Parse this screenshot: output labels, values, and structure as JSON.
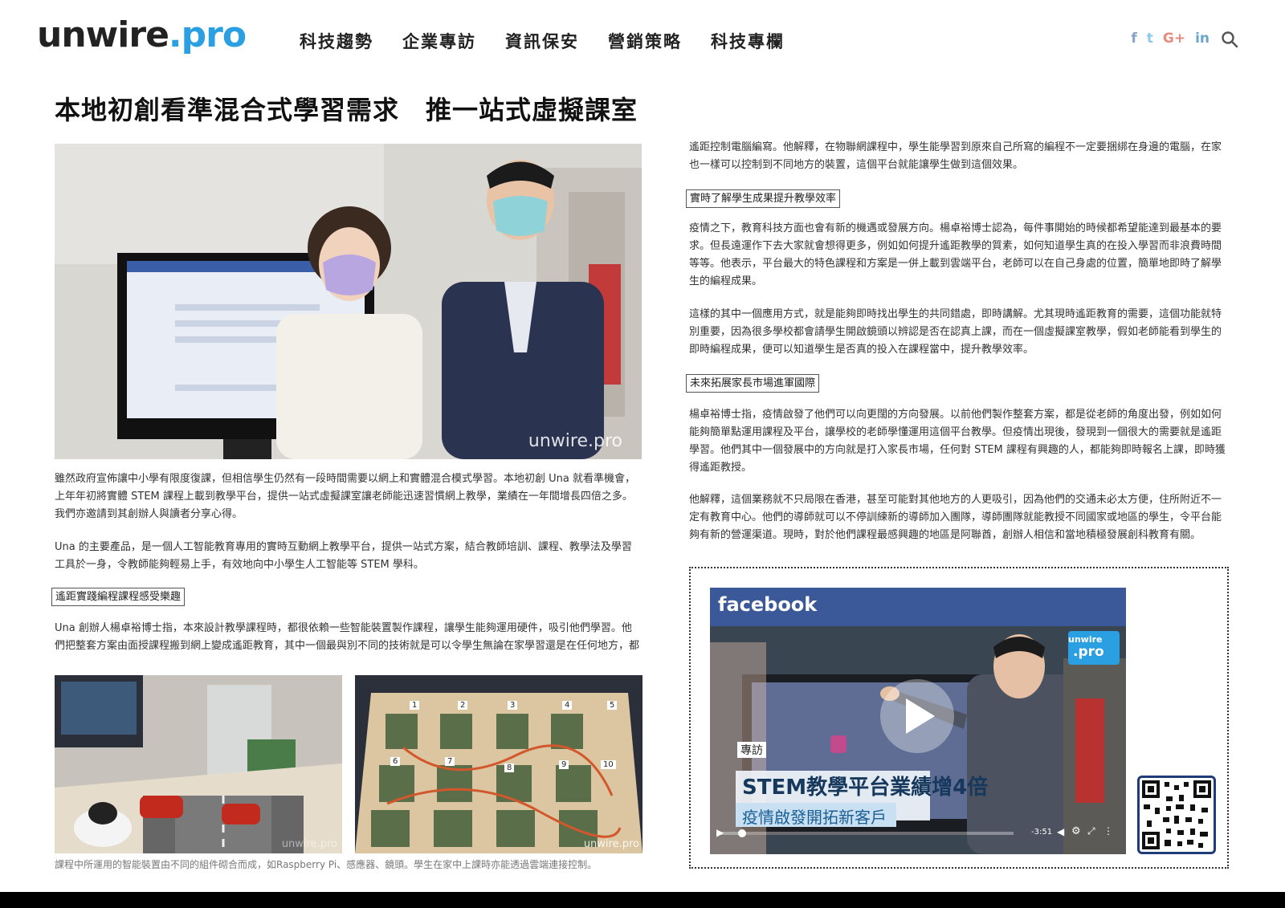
{
  "header": {
    "logo_main": "unwire",
    "logo_suffix": ".pro",
    "nav": [
      "科技趨勢",
      "企業專訪",
      "資訊保安",
      "營銷策略",
      "科技專欄"
    ],
    "social": [
      {
        "label": "f",
        "icon": "facebook-icon",
        "color": "#3b5998"
      },
      {
        "label": "t",
        "icon": "twitter-icon",
        "color": "#1da1f2"
      },
      {
        "label": "G+",
        "icon": "google-plus-icon",
        "color": "#dd4b39"
      },
      {
        "label": "in",
        "icon": "linkedin-icon",
        "color": "#0077b5"
      }
    ]
  },
  "article": {
    "title": "本地初創看準混合式學習需求　推一站式虛擬課室",
    "hero_watermark": "unwire.pro",
    "left": {
      "p1": "雖然政府宣佈讓中小學有限度復課，但相信學生仍然有一段時間需要以網上和實體混合模式學習。本地初創 Una 就看準機會，上年年初將實體 STEM 課程上載到教學平台，提供一站式虛擬課室讓老師能迅速習慣網上教學，業績在一年間增長四倍之多。我們亦邀請到其創辦人與讀者分享心得。",
      "p2": "Una 的主要產品，是一個人工智能教育專用的實時互動網上教學平台，提供一站式方案，結合教師培訓、課程、教學法及學習工具於一身，令教師能夠輕易上手，有效地向中小學生人工智能等 STEM 學科。",
      "sub1": "遙距實踐編程課程感受樂趣",
      "p3": "Una 創辦人楊卓裕博士指，本來設計教學課程時，都很依賴一些智能裝置製作課程，讓學生能夠運用硬件，吸引他們學習。他們把整套方案由面授課程搬到網上變成遙距教育，其中一個最與別不同的技術就是可以令學生無論在家學習還是在任何地方，都可以"
    },
    "photo2_watermark": "unwire.pro",
    "photo3_watermark": "unwire.pro",
    "photo3_numbers": [
      "1",
      "2",
      "3",
      "4",
      "5",
      "6",
      "7",
      "8",
      "9",
      "10"
    ],
    "caption": "課程中所運用的智能裝置由不同的組件砌合而成，如Raspberry Pi、感應器、鏡頭。學生在家中上課時亦能透過雲端連接控制。",
    "right": {
      "p1": "遙距控制電腦編寫。他解釋，在物聯網課程中，學生能學習到原來自己所寫的編程不一定要捆綁在身邊的電腦，在家也一樣可以控制到不同地方的裝置，這個平台就能讓學生做到這個效果。",
      "sub2": "實時了解學生成果提升教學效率",
      "p2": "疫情之下，教育科技方面也會有新的機遇或發展方向。楊卓裕博士認為，每件事開始的時候都希望能達到最基本的要求。但長遠運作下去大家就會想得更多，例如如何提升遙距教學的質素，如何知道學生真的在投入學習而非浪費時間等等。他表示，平台最大的特色課程和方案是一併上載到雲端平台，老師可以在自己身處的位置，簡單地即時了解學生的編程成果。",
      "p3": "這樣的其中一個應用方式，就是能夠即時找出學生的共同錯處，即時講解。尤其現時遙距教育的需要，這個功能就特別重要，因為很多學校都會請學生開啟鏡頭以辨認是否在認真上課，而在一個虛擬課室教學，假如老師能看到學生的即時編程成果，便可以知道學生是否真的投入在課程當中，提升教學效率。",
      "sub3": "未來拓展家長市場進軍國際",
      "p4": "楊卓裕博士指，疫情啟發了他們可以向更闊的方向發展。以前他們製作整套方案，都是從老師的角度出發，例如如何能夠簡單點運用課程及平台，讓學校的老師學懂運用這個平台教學。但疫情出現後，發現到一個很大的需要就是遙距學習。他們其中一個發展中的方向就是打入家長市場，任何對 STEM 課程有興趣的人，都能夠即時報名上課，即時獲得遙距教授。",
      "p5": "他解釋，這個業務就不只局限在香港，甚至可能對其他地方的人更吸引，因為他們的交通未必太方便，住所附近不一定有教育中心。他們的導師就可以不停訓練新的導師加入團隊，導師團隊就能教授不同國家或地區的學生，令平台能夠有新的營運渠道。現時，對於他們課程最感興趣的地區是阿聯酋，創辦人相信和當地積極發展創科教育有關。"
    }
  },
  "video": {
    "platform": "facebook",
    "badge": "專訪",
    "headline": "STEM教學平台業績增4倍",
    "subheadline": "疫情啟發開拓新客戶",
    "time": "-3:51",
    "logo_line1": "unwire",
    "logo_line2": ".pro"
  }
}
